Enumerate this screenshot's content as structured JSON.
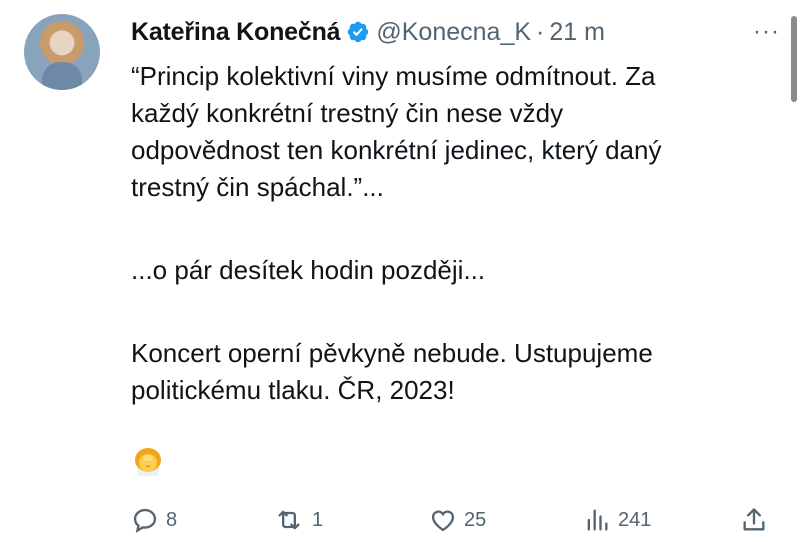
{
  "tweet": {
    "author_name": "Kateřina Konečná",
    "handle": "@Konecna_K",
    "separator": "·",
    "time": "21 m",
    "more_label": "···",
    "text": [
      "“Princip kolektivní viny musíme odmítnout. Za",
      "každý konkrétní trestný čin nese vždy",
      "odpovědnost ten konkrétní jedinec, který daný",
      "trestný čin spáchal.”...",
      "...o pár desítek hodin později...",
      "Koncert operní pěvkyně nebude. Ustupujeme",
      "politickému tlaku. ČR, 2023!"
    ],
    "emoji_icon": "woman-facepalming-icon"
  },
  "actions": {
    "replies": "8",
    "retweets": "1",
    "likes": "25",
    "views": "241"
  },
  "colors": {
    "verified": "#1d9bf0",
    "muted": "#536471",
    "text": "#0f1419"
  }
}
